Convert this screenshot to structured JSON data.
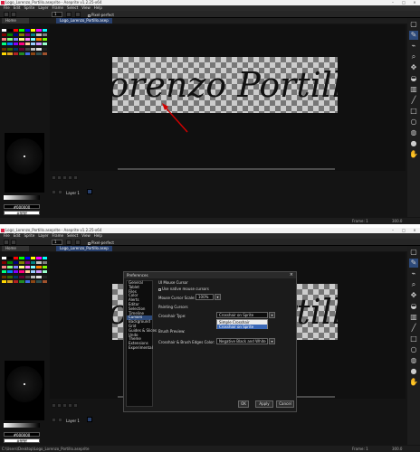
{
  "window": {
    "title_top": "Logo_Lorenzo_Portillo.aseprite - Aseprite v1.2.25-x64",
    "title_bottom": "Logo_Lorenzo_Portillo.aseprite - Aseprite v1.2.25-x64"
  },
  "menu": [
    "File",
    "Edit",
    "Sprite",
    "Layer",
    "Frame",
    "Select",
    "View",
    "Help"
  ],
  "toolbar": {
    "value": "1",
    "pixel_perfect_label": "Pixel-perfect"
  },
  "tabs": {
    "home": "Home",
    "file": "Logo_Lorenzo_Portillo.asep"
  },
  "sprite": {
    "text": "Lorenzo Portillo",
    "text_color": "#111111"
  },
  "colors": {
    "fg_hex": "#000000",
    "bg_hex": "#ffffff",
    "accent": "#28406d",
    "annotation_arrow": "#d40000"
  },
  "palette": [
    "#ffffff",
    "#000000",
    "#ff0000",
    "#00ff00",
    "#0000ff",
    "#ffff00",
    "#ff00ff",
    "#00ffff",
    "#800000",
    "#008000",
    "#000080",
    "#808000",
    "#800080",
    "#008080",
    "#c0c0c0",
    "#808080",
    "#ff8080",
    "#80ff80",
    "#8080ff",
    "#ffff80",
    "#ff80ff",
    "#80ffff",
    "#ff8000",
    "#80ff00",
    "#00ff80",
    "#0080ff",
    "#8000ff",
    "#ff0080",
    "#ffcc99",
    "#99ccff",
    "#cc99ff",
    "#99ffcc",
    "#663300",
    "#336600",
    "#003366",
    "#660033",
    "#444444",
    "#bbbbbb",
    "#e0e0e0",
    "#222222",
    "#ffd700",
    "#daa520",
    "#b22222",
    "#228b22",
    "#4169e1",
    "#8b4513",
    "#2f4f4f",
    "#a0522d"
  ],
  "timeline": {
    "layer": "Layer 1"
  },
  "statusbar": {
    "frame_label": "Frame:",
    "frame_value": "1",
    "zoom": "300.0",
    "path": "C:\\Users\\Desktop\\Logo_Lorenzo_Portillo.aseprite"
  },
  "preferences": {
    "title": "Preferences",
    "categories": [
      "General",
      "Tablet",
      "Files",
      "Color",
      "Alerts",
      "Editor",
      "Selection",
      "Timeline",
      "Cursors",
      "Background",
      "Grid",
      "Guides & Slices",
      "Undo",
      "Theme",
      "Extensions",
      "Experimental"
    ],
    "selected": "Cursors",
    "ui_cursor_heading": "UI Mouse Cursor",
    "native_cursor_label": "Use native mouse cursors",
    "cursor_scale_label": "Mouse Cursor Scale:",
    "cursor_scale_value": "100%",
    "painting_heading": "Painting Cursors",
    "crosshair_label": "Crosshair Type:",
    "crosshair_value": "Crosshair on Sprite",
    "crosshair_options": [
      "Simple Crosshair",
      "Crosshair on Sprite"
    ],
    "brush_preview_label": "Brush Preview:",
    "edges_label": "Crosshair & Brush Edges Color:",
    "edges_value": "Negative Black and White",
    "ok": "OK",
    "apply": "Apply",
    "cancel": "Cancel"
  }
}
